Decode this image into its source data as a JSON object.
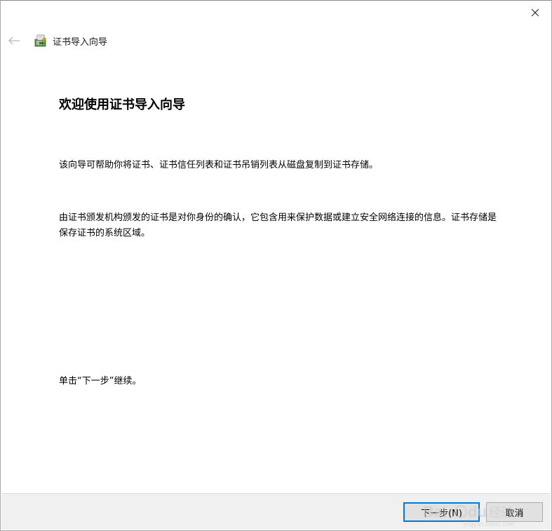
{
  "window": {
    "close_label": "✕"
  },
  "nav": {
    "back_icon": "arrow-left-icon",
    "wizard_icon": "certificate-icon",
    "title": "证书导入向导"
  },
  "main": {
    "heading": "欢迎使用证书导入向导",
    "paragraph1": "该向导可帮助你将证书、证书信任列表和证书吊销列表从磁盘复制到证书存储。",
    "paragraph2": "由证书颁发机构颁发的证书是对你身份的确认，它包含用来保护数据或建立安全网络连接的信息。证书存储是保存证书的系统区域。",
    "paragraph3": "单击“下一步”继续。"
  },
  "footer": {
    "next_label": "下一步(N)",
    "cancel_label": "取消"
  },
  "watermark": {
    "text": "Bai du 经验",
    "subtext": "jingyan.baidu.com"
  },
  "colors": {
    "accent": "#0078d7",
    "footer_bg": "#f0f0f0",
    "button_bg": "#e1e1e1"
  }
}
